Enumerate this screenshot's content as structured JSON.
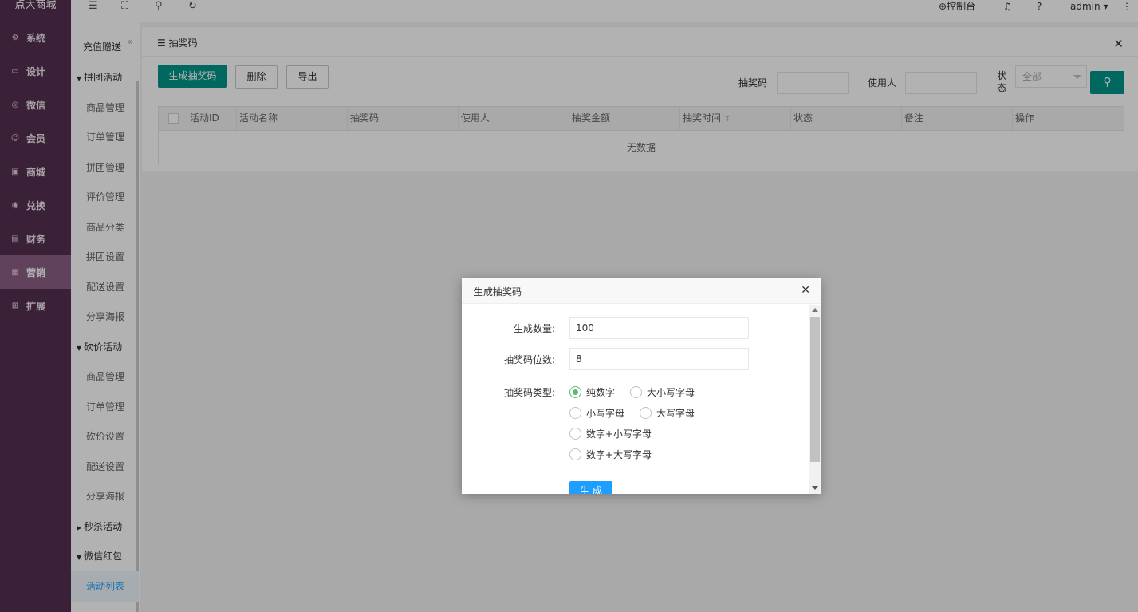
{
  "nav": {
    "brand": "点大商城",
    "items": [
      {
        "label": "系统",
        "icon": "gear-icon",
        "glyph": "⚙"
      },
      {
        "label": "设计",
        "icon": "monitor-icon",
        "glyph": "▭"
      },
      {
        "label": "微信",
        "icon": "wechat-icon",
        "glyph": "◎"
      },
      {
        "label": "会员",
        "icon": "user-icon",
        "glyph": "☺"
      },
      {
        "label": "商城",
        "icon": "shop-icon",
        "glyph": "▣"
      },
      {
        "label": "兑换",
        "icon": "exchange-icon",
        "glyph": "◉"
      },
      {
        "label": "财务",
        "icon": "finance-icon",
        "glyph": "▤"
      },
      {
        "label": "营销",
        "icon": "gift-icon",
        "glyph": "▦"
      },
      {
        "label": "扩展",
        "icon": "grid-icon",
        "glyph": "⊞"
      }
    ],
    "active_index": 7
  },
  "topbar": {
    "console_label": "控制台",
    "user": "admin"
  },
  "submenu": {
    "top_item": "充值赠送",
    "items": [
      {
        "label": "拼团活动",
        "type": "group",
        "expanded": true
      },
      {
        "label": "商品管理",
        "type": "leaf"
      },
      {
        "label": "订单管理",
        "type": "leaf"
      },
      {
        "label": "拼团管理",
        "type": "leaf"
      },
      {
        "label": "评价管理",
        "type": "leaf"
      },
      {
        "label": "商品分类",
        "type": "leaf"
      },
      {
        "label": "拼团设置",
        "type": "leaf"
      },
      {
        "label": "配送设置",
        "type": "leaf"
      },
      {
        "label": "分享海报",
        "type": "leaf"
      },
      {
        "label": "砍价活动",
        "type": "group",
        "expanded": true
      },
      {
        "label": "商品管理",
        "type": "leaf"
      },
      {
        "label": "订单管理",
        "type": "leaf"
      },
      {
        "label": "砍价设置",
        "type": "leaf"
      },
      {
        "label": "配送设置",
        "type": "leaf"
      },
      {
        "label": "分享海报",
        "type": "leaf"
      },
      {
        "label": "秒杀活动",
        "type": "group",
        "expanded": false
      },
      {
        "label": "微信红包",
        "type": "group",
        "expanded": true
      },
      {
        "label": "活动列表",
        "type": "leaf",
        "selected": true
      }
    ]
  },
  "panel": {
    "title": "抽奖码",
    "buttons": {
      "generate": "生成抽奖码",
      "delete": "删除",
      "export": "导出"
    },
    "filters": {
      "code_label": "抽奖码",
      "user_label": "使用人",
      "status_label": "状态",
      "status_value": "全部"
    },
    "table": {
      "columns": [
        "活动ID",
        "活动名称",
        "抽奖码",
        "使用人",
        "抽奖金额",
        "抽奖时间",
        "状态",
        "备注",
        "操作"
      ],
      "sort_glyph": "⇕",
      "empty_text": "无数据"
    }
  },
  "modal": {
    "title": "生成抽奖码",
    "fields": {
      "count_label": "生成数量:",
      "count_value": "100",
      "digits_label": "抽奖码位数:",
      "digits_value": "8",
      "type_label": "抽奖码类型:"
    },
    "types": [
      {
        "label": "纯数字",
        "checked": true
      },
      {
        "label": "大小写字母",
        "checked": false
      },
      {
        "label": "小写字母",
        "checked": false
      },
      {
        "label": "大写字母",
        "checked": false
      },
      {
        "label": "数字+小写字母",
        "checked": false
      },
      {
        "label": "数字+大写字母",
        "checked": false
      }
    ],
    "submit_label": "生 成"
  }
}
